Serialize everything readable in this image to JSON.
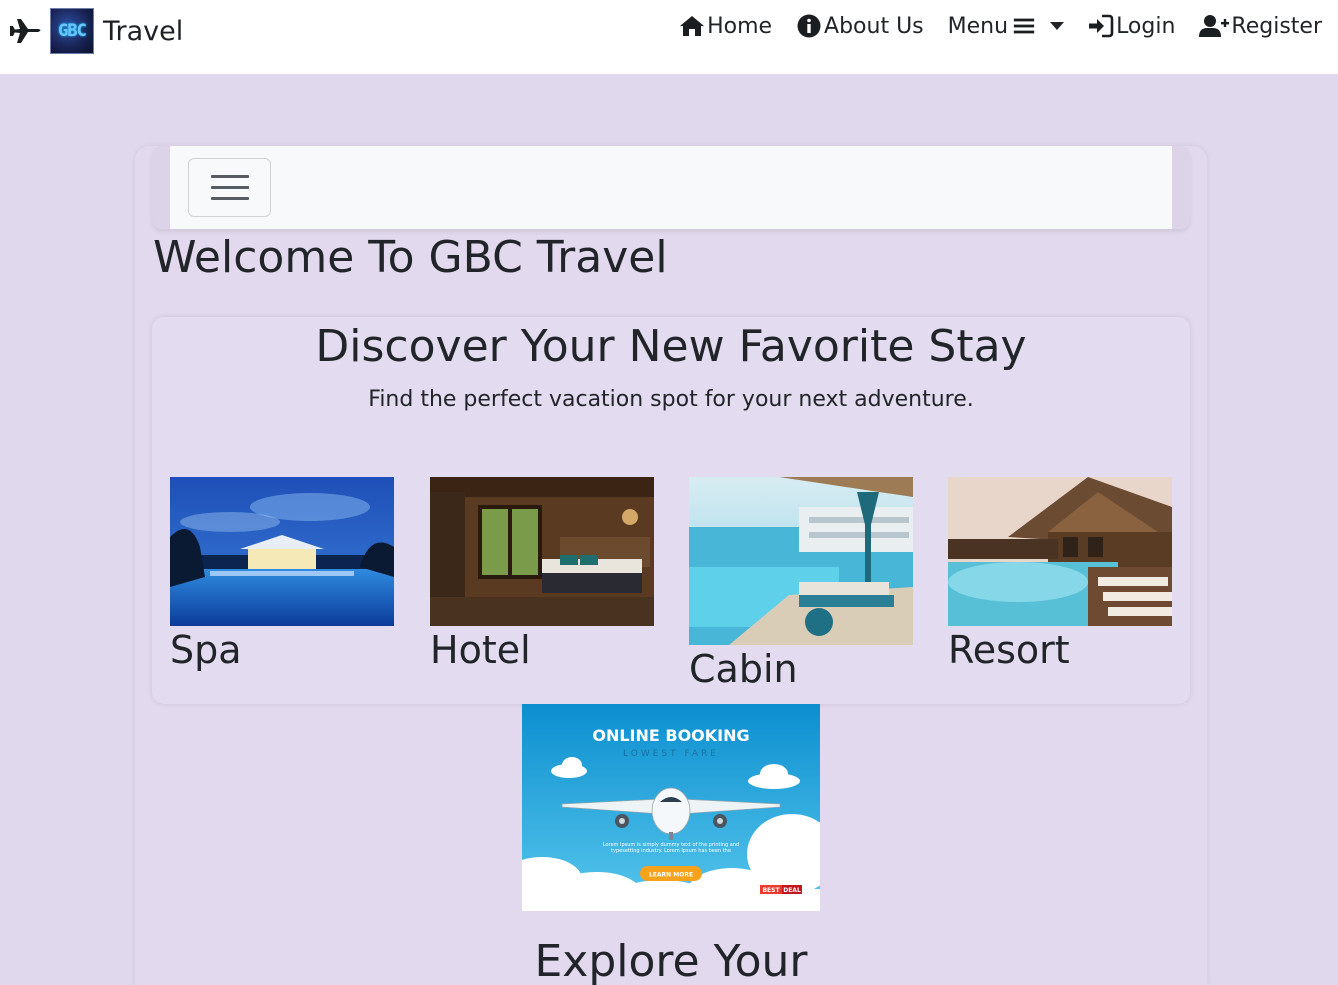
{
  "navbar": {
    "brand_logo_text": "GBC",
    "brand_text": "Travel",
    "items": [
      {
        "label": "Home",
        "icon": "home-icon"
      },
      {
        "label": "About Us",
        "icon": "info-icon"
      },
      {
        "label": "Menu",
        "icon": "bars-icon"
      },
      {
        "label": "Login",
        "icon": "sign-in-icon"
      },
      {
        "label": "Register",
        "icon": "user-plus-icon"
      }
    ]
  },
  "main": {
    "welcome_title": "Welcome To GBC Travel",
    "discover": {
      "title": "Discover Your New Favorite Stay",
      "subtitle": "Find the perfect vacation spot for your next adventure.",
      "stays": [
        {
          "label": "Spa"
        },
        {
          "label": "Hotel"
        },
        {
          "label": "Cabin"
        },
        {
          "label": "Resort"
        }
      ]
    },
    "banner": {
      "title": "ONLINE BOOKING",
      "subtitle": "LOWEST FARE",
      "body": "Lorem Ipsum is simply dummy text of the printing and typesetting industry. Lorem Ipsum has been the",
      "button": "LEARN MORE",
      "badge_left": "BEST",
      "badge_right": "DEAL"
    },
    "explore_title": "Explore Your"
  }
}
